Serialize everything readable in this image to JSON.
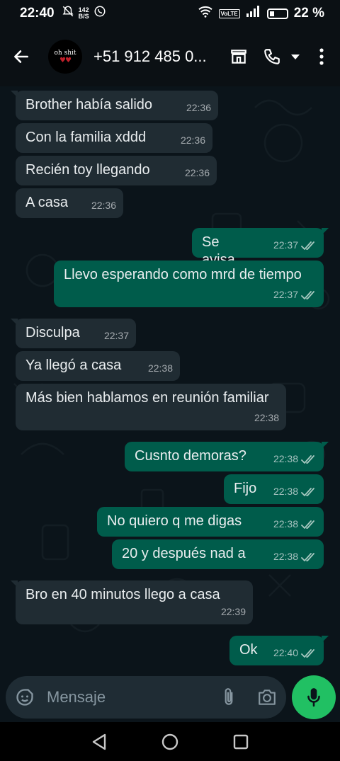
{
  "status_bar": {
    "time": "22:40",
    "speed_value": "142",
    "speed_unit": "B/S",
    "volte": "VoLTE",
    "battery": "22 %"
  },
  "header": {
    "contact": "+51 912 485 0...",
    "avatar_text": "oh shit",
    "icons": [
      "back-arrow-icon",
      "store-icon",
      "phone-icon",
      "dropdown-icon",
      "more-vert-icon"
    ]
  },
  "messages": [
    {
      "dir": "in",
      "text": "Brother había salido",
      "time": "22:36"
    },
    {
      "dir": "in",
      "text": "Con la familia xddd",
      "time": "22:36"
    },
    {
      "dir": "in",
      "text": "Recién toy llegando",
      "time": "22:36"
    },
    {
      "dir": "in",
      "text": "A casa",
      "time": "22:36"
    },
    {
      "dir": "out",
      "text": "Se avisa",
      "time": "22:37"
    },
    {
      "dir": "out",
      "text": "Llevo esperando como mrd de tiempo",
      "time": "22:37"
    },
    {
      "dir": "in",
      "text": "Disculpa",
      "time": "22:37"
    },
    {
      "dir": "in",
      "text": "Ya llegó a casa",
      "time": "22:38"
    },
    {
      "dir": "in",
      "text": "Más bien hablamos en reunión familiar",
      "time": "22:38"
    },
    {
      "dir": "out",
      "text": "Cusnto demoras?",
      "time": "22:38"
    },
    {
      "dir": "out",
      "text": "Fijo",
      "time": "22:38"
    },
    {
      "dir": "out",
      "text": "No quiero q me digas",
      "time": "22:38"
    },
    {
      "dir": "out",
      "text": "20 y después nad a",
      "time": "22:38"
    },
    {
      "dir": "in",
      "text": "Bro en 40 minutos llego a casa",
      "time": "22:39"
    },
    {
      "dir": "out",
      "text": "Ok",
      "time": "22:40"
    }
  ],
  "input": {
    "placeholder": "Mensaje"
  },
  "colors": {
    "incoming": "#202c33",
    "outgoing": "#005c4b",
    "mic": "#21c063",
    "background": "#0b141a"
  }
}
